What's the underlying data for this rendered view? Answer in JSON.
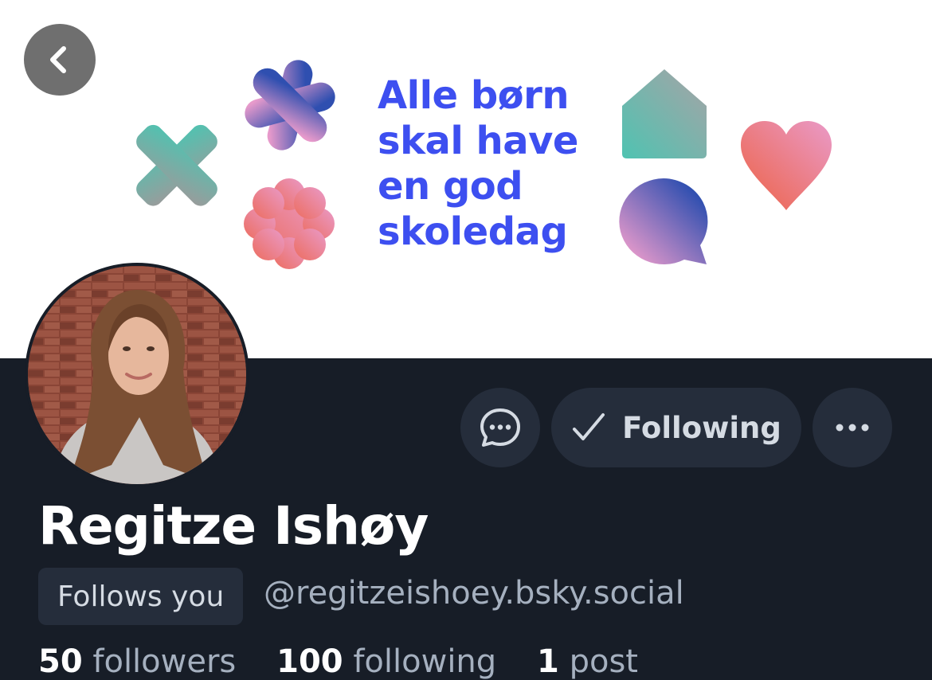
{
  "banner": {
    "lines": [
      "Alle børn",
      "skal have",
      "en god",
      "skoledag"
    ],
    "text_color": "#3d4ff0"
  },
  "nav": {
    "back_icon": "chevron-left-icon"
  },
  "actions": {
    "message_icon": "chat-bubble-icon",
    "following_label": "Following",
    "following_icon": "checkmark-icon",
    "more_icon": "ellipsis-icon"
  },
  "profile": {
    "display_name": "Regitze Ishøy",
    "follows_you_label": "Follows you",
    "handle": "@regitzeishoey.bsky.social"
  },
  "stats": {
    "followers_count": "50",
    "followers_label": "followers",
    "following_count": "100",
    "following_label": "following",
    "posts_count": "1",
    "posts_label": "post"
  },
  "colors": {
    "background": "#171d27",
    "button_bg": "#252d3b",
    "text_primary": "#ffffff",
    "text_secondary": "#a5b0bf"
  }
}
